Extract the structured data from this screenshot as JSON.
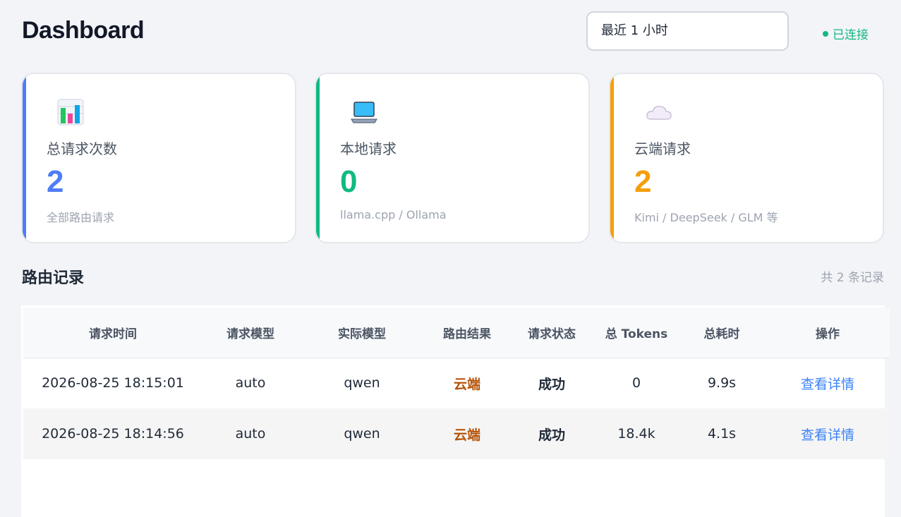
{
  "header": {
    "title": "Dashboard",
    "time_range": "最近 1 小时",
    "connection_status": "已连接",
    "connection_color": "#10b981"
  },
  "stats": [
    {
      "icon": "bar-chart-icon",
      "label": "总请求次数",
      "value": "2",
      "sub": "全部路由请求",
      "color": "#4f7cf7"
    },
    {
      "icon": "laptop-icon",
      "label": "本地请求",
      "value": "0",
      "sub": "llama.cpp / Ollama",
      "color": "#10b981"
    },
    {
      "icon": "cloud-icon",
      "label": "云端请求",
      "value": "2",
      "sub": "Kimi / DeepSeek / GLM 等",
      "color": "#f59e0b"
    }
  ],
  "records": {
    "title": "路由记录",
    "count_text": "共 2 条记录",
    "columns": [
      "请求时间",
      "请求模型",
      "实际模型",
      "路由结果",
      "请求状态",
      "总 Tokens",
      "总耗时",
      "操作"
    ],
    "rows": [
      {
        "time": "2026-08-25 18:15:01",
        "req_model": "auto",
        "actual_model": "qwen",
        "route": "云端",
        "status": "成功",
        "tokens": "0",
        "duration": "9.9s",
        "action": "查看详情"
      },
      {
        "time": "2026-08-25 18:14:56",
        "req_model": "auto",
        "actual_model": "qwen",
        "route": "云端",
        "status": "成功",
        "tokens": "18.4k",
        "duration": "4.1s",
        "action": "查看详情"
      }
    ]
  }
}
